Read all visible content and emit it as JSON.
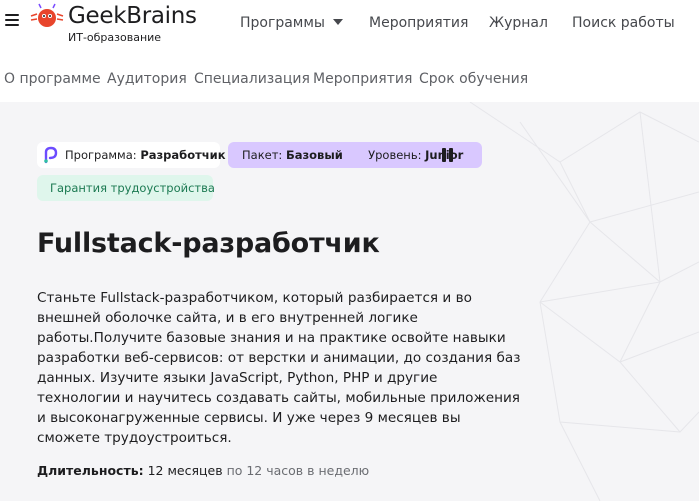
{
  "header": {
    "logo_name": "GeekBrains",
    "logo_subtitle": "ИТ-образование",
    "nav": [
      {
        "label": "Программы"
      },
      {
        "label": "Мероприятия"
      },
      {
        "label": "Журнал"
      },
      {
        "label": "Поиск работы"
      }
    ]
  },
  "subnav": [
    {
      "label": "О программе"
    },
    {
      "label": "Аудитория"
    },
    {
      "label": "Специализация"
    },
    {
      "label": "Мероприятия"
    },
    {
      "label": "Срок обучения"
    }
  ],
  "chips": {
    "program_label": "Программа:",
    "program_value": "Разработчик",
    "package_label": "Пакет:",
    "package_value": "Базовый",
    "level_label": "Уровень:",
    "level_value": "Junior",
    "guarantee": "Гарантия трудоустройства"
  },
  "course": {
    "title": "Fullstack-разработчик",
    "description": "Станьте Fullstack-разработчиком, который разбирается и во внешней оболочке сайта, и в его внутренней логике работы.Получите базовые знания и на практике освойте навыки разработки веб-сервисов: от верстки и анимации, до создания баз данных. Изучите языки JavaScript, Python, PHP и другие технологии и научитесь создавать сайты, мобильные приложения и высоконагруженные сервисы. И уже через 9 месяцев вы сможете трудоустроиться.",
    "duration_label": "Длительность:",
    "duration_value": "12 месяцев",
    "duration_rest": "по 12 часов в неделю"
  },
  "colors": {
    "accent_purple": "#d9c8ff",
    "guarantee_bg": "#dff6ec",
    "guarantee_text": "#1c7a52",
    "logo_red": "#e8452c"
  },
  "icons": [
    "menu-icon",
    "geekbrains-logo-icon",
    "chevron-down-icon",
    "program-logo-icon",
    "level-bars-icon"
  ]
}
